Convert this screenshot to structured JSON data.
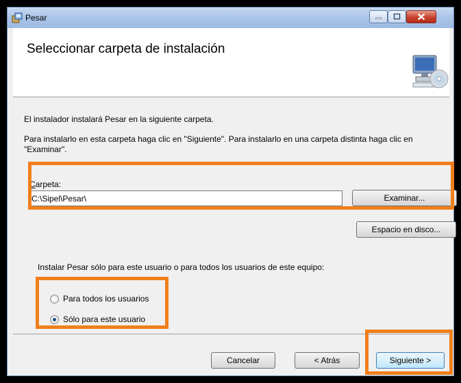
{
  "window": {
    "title": "Pesar",
    "controls": {
      "minimize": "minimize-icon",
      "maximize": "maximize-icon",
      "close": "close-icon"
    }
  },
  "header": {
    "title": "Seleccionar carpeta de instalación",
    "icon": "computer-cd-icon"
  },
  "main": {
    "intro": "El instalador instalará Pesar en la siguiente carpeta.",
    "instructions": "Para instalarlo en esta carpeta haga clic en \"Siguiente\". Para instalarlo en una carpeta distinta haga clic en \"Examinar\".",
    "folder_label_first": "C",
    "folder_label_rest": "arpeta:",
    "folder_value": "C:\\Sipel\\Pesar\\",
    "browse_button": "Examinar...",
    "disk_space_button": "Espacio en disco...",
    "question": "Instalar Pesar sólo para este usuario o para todos los usuarios de este equipo:",
    "options": [
      {
        "label": "Para todos los usuarios",
        "checked": false
      },
      {
        "label": "Sólo para este usuario",
        "checked": true
      }
    ]
  },
  "footer": {
    "cancel": "Cancelar",
    "back": "< Atrás",
    "next": "Siguiente >"
  },
  "colors": {
    "highlight": "#f07f1b",
    "window_bg": "#f0f0f0",
    "header_bg": "#ffffff"
  }
}
